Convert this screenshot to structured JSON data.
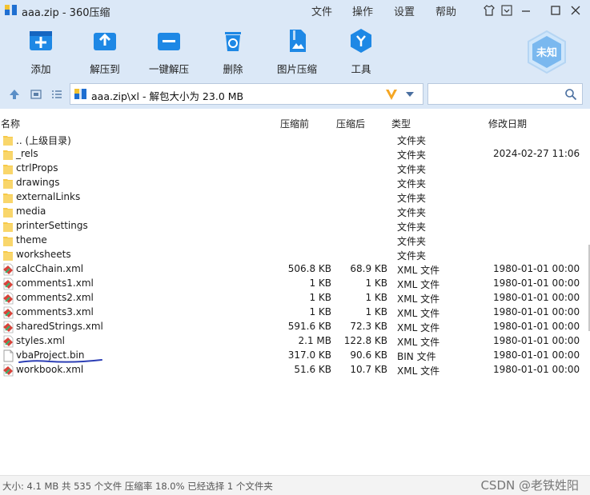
{
  "window": {
    "title": "aaa.zip - 360压缩",
    "menu": [
      "文件",
      "操作",
      "设置",
      "帮助"
    ]
  },
  "toolbar": {
    "tools": [
      {
        "label": "添加",
        "icon": "add-icon"
      },
      {
        "label": "解压到",
        "icon": "extract-to-icon"
      },
      {
        "label": "一键解压",
        "icon": "one-click-extract-icon"
      },
      {
        "label": "删除",
        "icon": "delete-icon"
      },
      {
        "label": "图片压缩",
        "icon": "image-compress-icon"
      },
      {
        "label": "工具",
        "icon": "tools-icon"
      }
    ],
    "badge_label": "未知"
  },
  "address": {
    "path": "aaa.zip\\xl - 解包大小为 23.0 MB",
    "search_placeholder": ""
  },
  "columns": {
    "name": "名称",
    "before": "压缩前",
    "after": "压缩后",
    "type": "类型",
    "date": "修改日期"
  },
  "files": [
    {
      "name": ".. (上级目录)",
      "before": "",
      "after": "",
      "type": "文件夹",
      "date": "",
      "kind": "folder"
    },
    {
      "name": "_rels",
      "before": "",
      "after": "",
      "type": "文件夹",
      "date": "2024-02-27 11:06",
      "kind": "folder"
    },
    {
      "name": "ctrlProps",
      "before": "",
      "after": "",
      "type": "文件夹",
      "date": "",
      "kind": "folder"
    },
    {
      "name": "drawings",
      "before": "",
      "after": "",
      "type": "文件夹",
      "date": "",
      "kind": "folder"
    },
    {
      "name": "externalLinks",
      "before": "",
      "after": "",
      "type": "文件夹",
      "date": "",
      "kind": "folder"
    },
    {
      "name": "media",
      "before": "",
      "after": "",
      "type": "文件夹",
      "date": "",
      "kind": "folder"
    },
    {
      "name": "printerSettings",
      "before": "",
      "after": "",
      "type": "文件夹",
      "date": "",
      "kind": "folder"
    },
    {
      "name": "theme",
      "before": "",
      "after": "",
      "type": "文件夹",
      "date": "",
      "kind": "folder"
    },
    {
      "name": "worksheets",
      "before": "",
      "after": "",
      "type": "文件夹",
      "date": "",
      "kind": "folder"
    },
    {
      "name": "calcChain.xml",
      "before": "506.8 KB",
      "after": "68.9 KB",
      "type": "XML 文件",
      "date": "1980-01-01 00:00",
      "kind": "xml"
    },
    {
      "name": "comments1.xml",
      "before": "1 KB",
      "after": "1 KB",
      "type": "XML 文件",
      "date": "1980-01-01 00:00",
      "kind": "xml"
    },
    {
      "name": "comments2.xml",
      "before": "1 KB",
      "after": "1 KB",
      "type": "XML 文件",
      "date": "1980-01-01 00:00",
      "kind": "xml"
    },
    {
      "name": "comments3.xml",
      "before": "1 KB",
      "after": "1 KB",
      "type": "XML 文件",
      "date": "1980-01-01 00:00",
      "kind": "xml"
    },
    {
      "name": "sharedStrings.xml",
      "before": "591.6 KB",
      "after": "72.3 KB",
      "type": "XML 文件",
      "date": "1980-01-01 00:00",
      "kind": "xml"
    },
    {
      "name": "styles.xml",
      "before": "2.1 MB",
      "after": "122.8 KB",
      "type": "XML 文件",
      "date": "1980-01-01 00:00",
      "kind": "xml"
    },
    {
      "name": "vbaProject.bin",
      "before": "317.0 KB",
      "after": "90.6 KB",
      "type": "BIN 文件",
      "date": "1980-01-01 00:00",
      "kind": "bin"
    },
    {
      "name": "workbook.xml",
      "before": "51.6 KB",
      "after": "10.7 KB",
      "type": "XML 文件",
      "date": "1980-01-01 00:00",
      "kind": "xml"
    }
  ],
  "status": {
    "text": "大小: 4.1 MB 共 535 个文件 压缩率 18.0% 已经选择 1 个文件夹",
    "watermark": "CSDN @老铁姓阳"
  },
  "colors": {
    "accent": "#1e88e5",
    "chrome": "#dbe8f7",
    "folder": "#f7c948",
    "annotation": "#2d3fb5"
  }
}
